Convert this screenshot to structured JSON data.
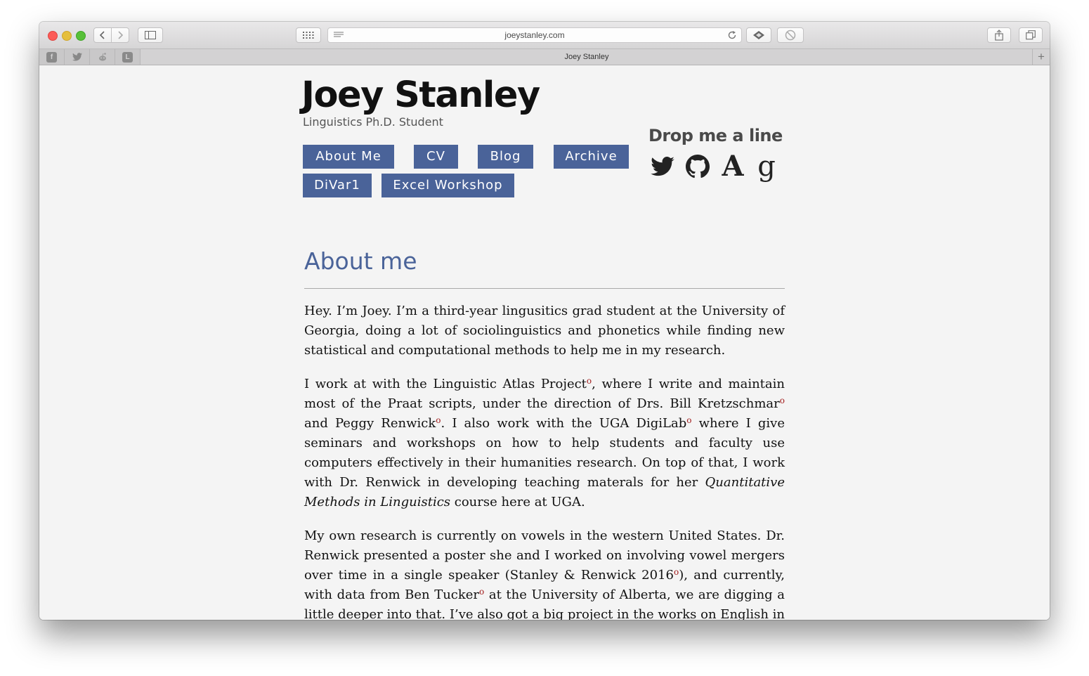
{
  "browser": {
    "url": "joeystanley.com",
    "tab_title": "Joey Stanley",
    "new_tab_label": "+",
    "pinned_tabs": [
      {
        "icon": "facebook-icon",
        "glyph": "f"
      },
      {
        "icon": "twitter-icon",
        "glyph": "t"
      },
      {
        "icon": "reddit-icon",
        "glyph": "r"
      },
      {
        "icon": "l-icon",
        "glyph": "L"
      }
    ]
  },
  "site": {
    "title": "Joey Stanley",
    "subtitle": "Linguistics Ph.D. Student",
    "nav": [
      {
        "label": "About Me"
      },
      {
        "label": "CV"
      },
      {
        "label": "Blog"
      },
      {
        "label": "Archive"
      },
      {
        "label": "DiVar1"
      },
      {
        "label": "Excel Workshop"
      }
    ],
    "contact": {
      "title": "Drop me a line",
      "links": [
        "twitter-icon",
        "github-icon",
        "academia-icon",
        "google-scholar-icon"
      ],
      "academia_glyph": "A",
      "google_glyph": "g"
    }
  },
  "about": {
    "heading": "About me",
    "p1": "Hey. I’m Joey. I’m a third-year lingusitics grad student at the University of Georgia, doing a lot of sociolinguistics and phonetics while finding new statistical and computational methods to help me in my research.",
    "p2": {
      "t1": "I work at with the ",
      "link1": "Linguistic Atlas Project",
      "t2": ", where I write and maintain most of the Praat scripts, under the direction of Drs. ",
      "link2": "Bill Kretzschmar",
      "t3": " and ",
      "link3": "Peggy Renwick",
      "t4": ". I also work with the ",
      "link4": "UGA DigiLab",
      "t5": " where I give seminars and workshops on how to help students and faculty use computers effectively in their humanities research. On top of that, I work with Dr. Renwick in developing teaching materals for her ",
      "em": "Quantitative Methods in Linguistics",
      "t6": " course here at UGA."
    },
    "p3": {
      "t1": "My own research is currently on vowels in the western United States. Dr. Renwick presented a poster she and I worked on involving vowel mergers over time in a single speaker (",
      "link1": "Stanley & Renwick 2016",
      "t2": "), and currently, with data from ",
      "link2": "Ben Tucker",
      "t3": " at the University of Alberta, we are digging a little deeper into that. I’ve also got a big project in the works on English in the"
    },
    "ext_mark": "o"
  }
}
